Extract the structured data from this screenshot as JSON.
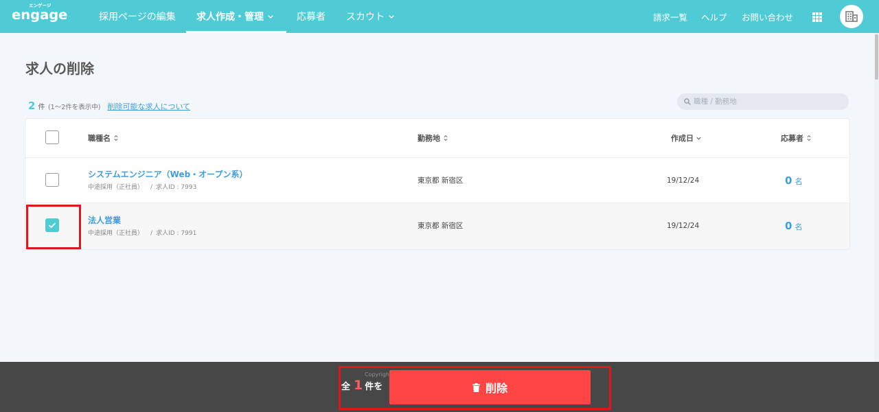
{
  "colors": {
    "accent": "#4ecbd5",
    "link": "#3f9ddc",
    "danger": "#ff4545",
    "count_highlight": "#ff5c60",
    "action_bar": "#474747",
    "page_background": "#f3f6fa",
    "annotation": "#e0161d"
  },
  "header": {
    "logo_text": "engage",
    "logo_kana": "エンゲージ",
    "nav": [
      {
        "label": "採用ページの編集",
        "active": false,
        "dropdown": false
      },
      {
        "label": "求人作成・管理",
        "active": true,
        "dropdown": true
      },
      {
        "label": "応募者",
        "active": false,
        "dropdown": false
      },
      {
        "label": "スカウト",
        "active": false,
        "dropdown": true
      }
    ],
    "right_links": [
      {
        "label": "請求一覧"
      },
      {
        "label": "ヘルプ"
      },
      {
        "label": "お問い合わせ"
      }
    ],
    "apps_icon": "grid-icon",
    "account_icon": "building-icon"
  },
  "page": {
    "title": "求人の削除",
    "result_count": "2",
    "result_unit": "件",
    "result_range": "(1～2件を表示中)",
    "help_link": "削除可能な求人について",
    "search": {
      "placeholder": "職種 / 勤務地",
      "value": "",
      "icon": "search-icon"
    }
  },
  "table": {
    "select_all_checked": false,
    "columns": [
      {
        "label": "職種名",
        "sort_icon": "sort-icon"
      },
      {
        "label": "勤務地",
        "sort_icon": "sort-icon"
      },
      {
        "label": "作成日",
        "sort_icon": "chevron-down-icon"
      },
      {
        "label": "応募者",
        "sort_icon": "sort-icon"
      }
    ],
    "rows": [
      {
        "checked": false,
        "title": "システムエンジニア（Web・オープン系）",
        "employment_type": "中途採用（正社員）",
        "separator": "/",
        "job_id": "求人ID : 7993",
        "location": "東京都 新宿区",
        "created": "19/12/24",
        "applicants": "0",
        "applicants_unit": "名"
      },
      {
        "checked": true,
        "title": "法人営業",
        "employment_type": "中途採用（正社員）",
        "separator": "/",
        "job_id": "求人ID : 7991",
        "location": "東京都 新宿区",
        "created": "19/12/24",
        "applicants": "0",
        "applicants_unit": "名"
      }
    ]
  },
  "action_bar": {
    "prefix": "全",
    "selected_count": "1",
    "suffix": "件を",
    "delete_label": "削除",
    "delete_icon": "trash-icon",
    "copyright_fragment": "Copyrigh"
  }
}
